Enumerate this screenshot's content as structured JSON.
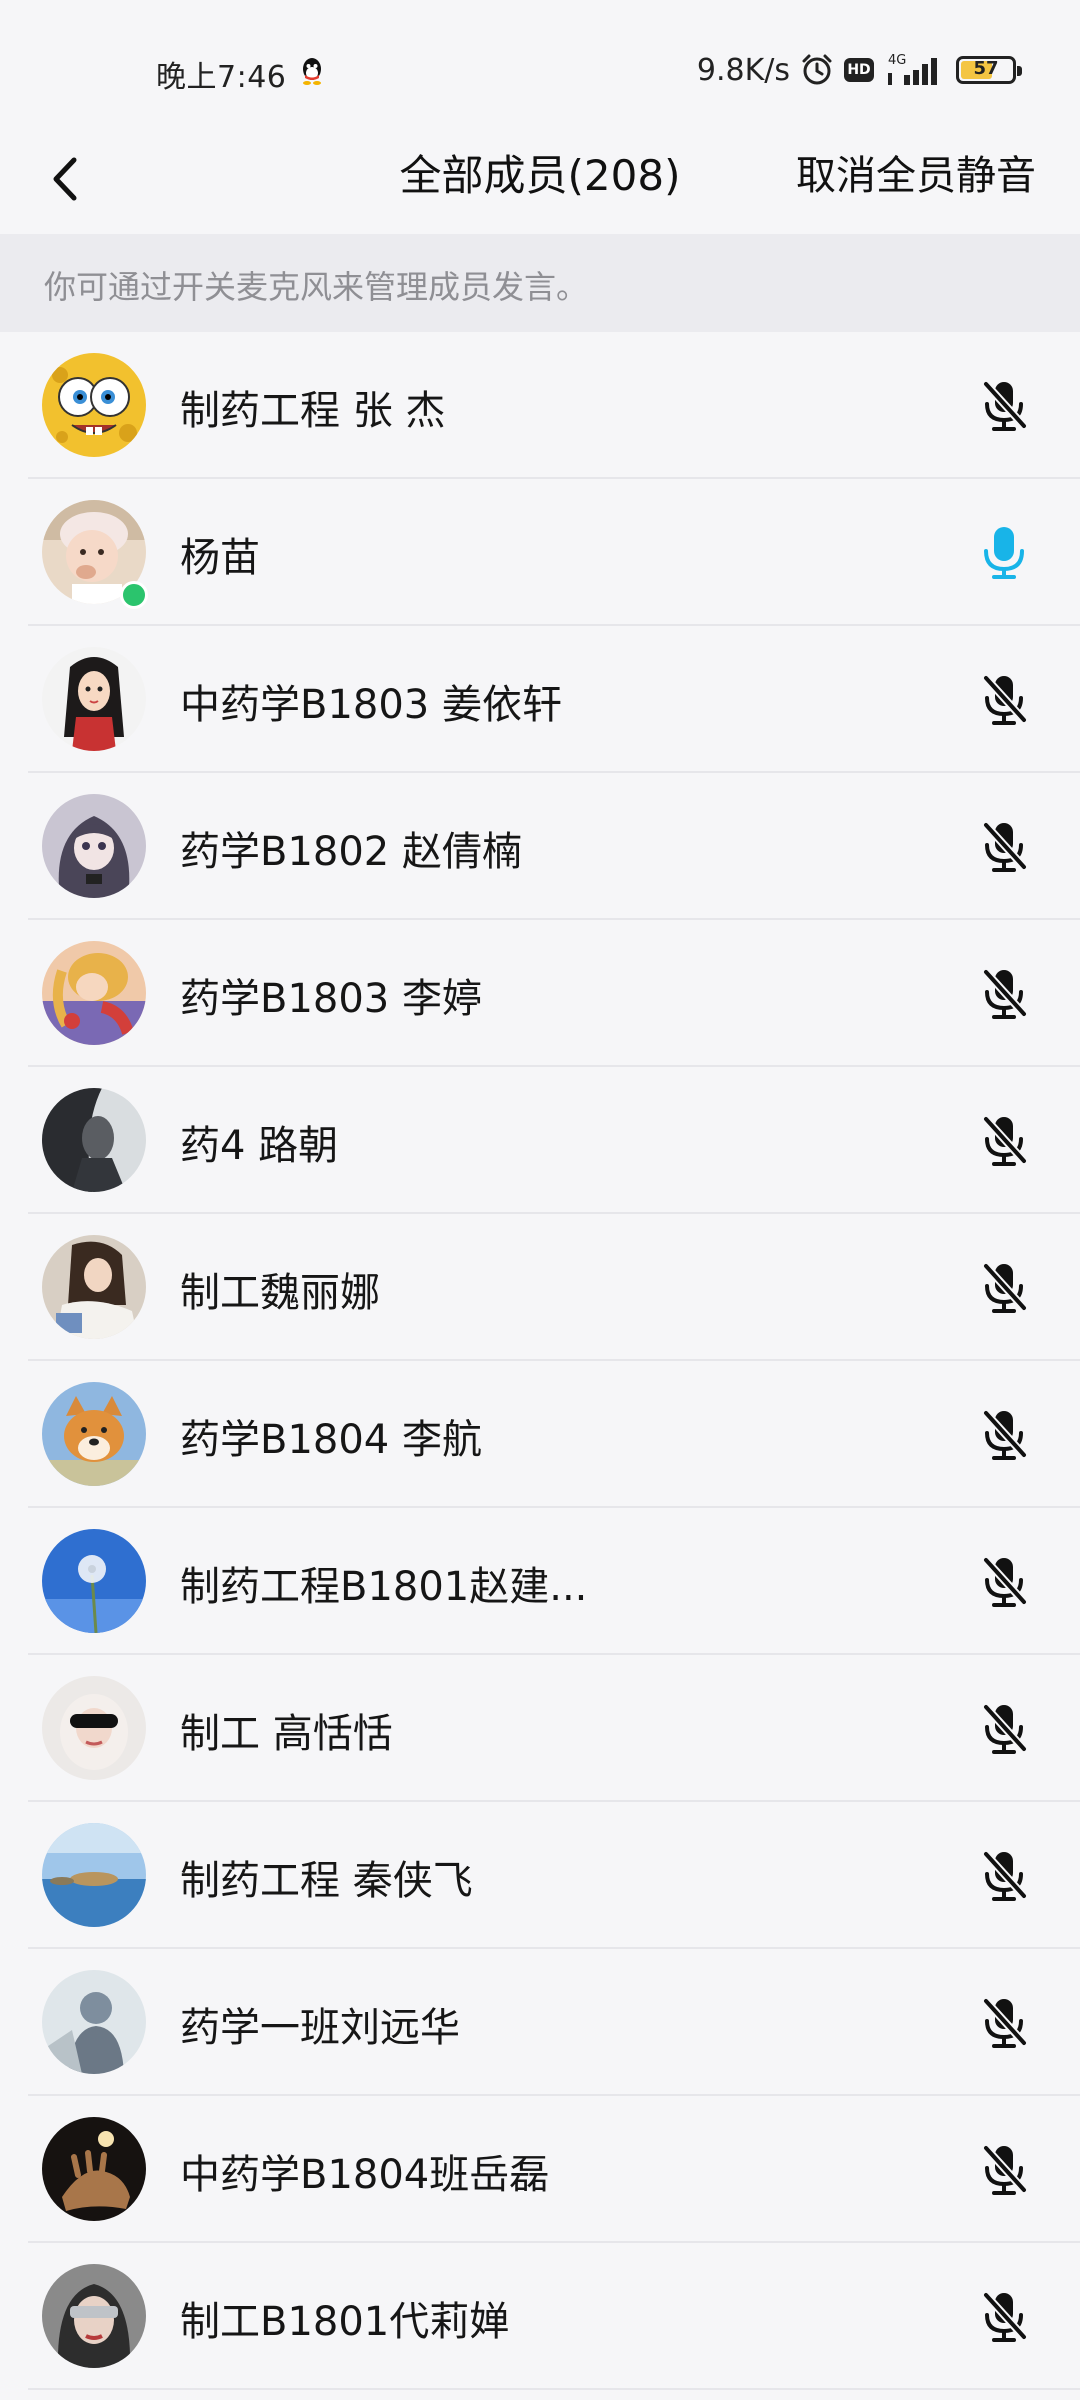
{
  "status_bar": {
    "time": "晚上7:46",
    "net_speed": "9.8K/s",
    "network": "4G",
    "hd": "HD",
    "battery": "57"
  },
  "header": {
    "title": "全部成员(208)",
    "action": "取消全员静音"
  },
  "tip": "你可通过开关麦克风来管理成员发言。",
  "colors": {
    "mic_on": "#18b4e8",
    "mic_off": "#111111",
    "talk_badge": "#2bc46d"
  },
  "members": [
    {
      "name": "制药工程 张 杰",
      "mic": "muted"
    },
    {
      "name": "杨苗",
      "mic": "on"
    },
    {
      "name": "中药学B1803  姜依轩",
      "mic": "muted"
    },
    {
      "name": "药学B1802 赵倩楠",
      "mic": "muted"
    },
    {
      "name": "药学B1803 李婷",
      "mic": "muted"
    },
    {
      "name": "药4  路朝",
      "mic": "muted"
    },
    {
      "name": "制工魏丽娜",
      "mic": "muted"
    },
    {
      "name": "药学B1804 李航",
      "mic": "muted"
    },
    {
      "name": "制药工程B1801赵建...",
      "mic": "muted"
    },
    {
      "name": "制工 高恬恬",
      "mic": "muted"
    },
    {
      "name": "制药工程  秦侠飞",
      "mic": "muted"
    },
    {
      "name": "药学一班刘远华",
      "mic": "muted"
    },
    {
      "name": "中药学B1804班岳磊",
      "mic": "muted"
    },
    {
      "name": "制工B1801代莉婵",
      "mic": "muted"
    }
  ]
}
